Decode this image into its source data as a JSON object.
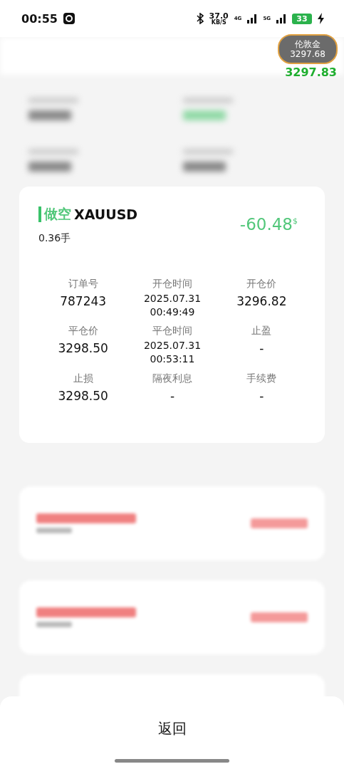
{
  "status_bar": {
    "time": "00:55",
    "net_speed": "37.0",
    "net_unit": "KB/S",
    "network_1": "4G",
    "network_2": "5G",
    "battery": "33"
  },
  "price_badge": {
    "name": "伦敦金",
    "price": "3297.68",
    "quote": "3297.83"
  },
  "order": {
    "side": "做空",
    "symbol": "XAUUSD",
    "lots": "0.36手",
    "profit": "-60.48",
    "currency": "$",
    "fields": [
      {
        "label": "订单号",
        "value": "787243"
      },
      {
        "label": "开仓时间",
        "value": "2025.07.31",
        "value_2": "00:49:49"
      },
      {
        "label": "开仓价",
        "value": "3296.82"
      },
      {
        "label": "平仓价",
        "value": "3298.50"
      },
      {
        "label": "平仓时间",
        "value": "2025.07.31",
        "value_2": "00:53:11"
      },
      {
        "label": "止盈",
        "value": "-"
      },
      {
        "label": "止损",
        "value": "3298.50"
      },
      {
        "label": "隔夜利息",
        "value": "-"
      },
      {
        "label": "手续费",
        "value": "-"
      }
    ]
  },
  "back_button": "返回"
}
